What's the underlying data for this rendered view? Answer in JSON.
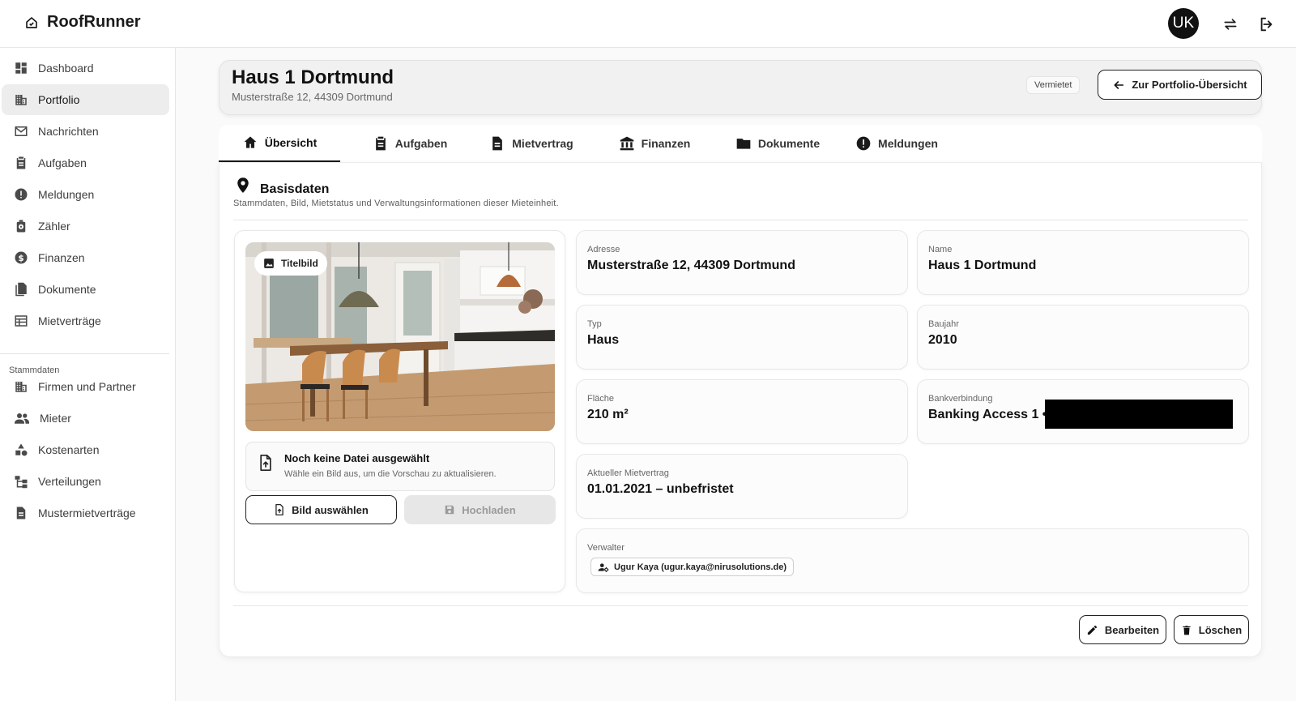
{
  "app": {
    "name": "RoofRunner"
  },
  "user": {
    "initials": "UK"
  },
  "sidebar": {
    "items": [
      {
        "label": "Dashboard",
        "icon": "dashboard-icon"
      },
      {
        "label": "Portfolio",
        "icon": "building-icon",
        "active": true
      },
      {
        "label": "Nachrichten",
        "icon": "mail-icon"
      },
      {
        "label": "Aufgaben",
        "icon": "clipboard-icon"
      },
      {
        "label": "Meldungen",
        "icon": "alert-icon"
      },
      {
        "label": "Zähler",
        "icon": "meter-icon"
      },
      {
        "label": "Finanzen",
        "icon": "dollar-icon"
      },
      {
        "label": "Dokumente",
        "icon": "documents-icon"
      },
      {
        "label": "Mietverträge",
        "icon": "table-icon"
      }
    ],
    "section_label": "Stammdaten",
    "section_items": [
      {
        "label": "Firmen und Partner",
        "icon": "building-icon"
      },
      {
        "label": "Mieter",
        "icon": "people-icon"
      },
      {
        "label": "Kostenarten",
        "icon": "category-icon"
      },
      {
        "label": "Verteilungen",
        "icon": "tree-icon"
      },
      {
        "label": "Mustermietverträge",
        "icon": "document-icon"
      }
    ]
  },
  "header": {
    "title": "Haus 1 Dortmund",
    "subtitle": "Musterstraße 12, 44309 Dortmund",
    "status_badge": "Vermietet",
    "back_button": "Zur Portfolio-Übersicht"
  },
  "tabs": [
    {
      "label": "Übersicht",
      "icon": "home-icon",
      "active": true
    },
    {
      "label": "Aufgaben",
      "icon": "clipboard-icon"
    },
    {
      "label": "Mietvertrag",
      "icon": "document-icon"
    },
    {
      "label": "Finanzen",
      "icon": "bank-icon"
    },
    {
      "label": "Dokumente",
      "icon": "folder-icon"
    },
    {
      "label": "Meldungen",
      "icon": "alert-icon"
    }
  ],
  "section": {
    "title": "Basisdaten",
    "subtitle": "Stammdaten, Bild, Mietstatus und Verwaltungsinformationen dieser Mieteinheit."
  },
  "image_card": {
    "chip_label": "Titelbild",
    "file_title": "Noch keine Datei ausgewählt",
    "file_hint": "Wähle ein Bild aus, um die Vorschau zu aktualisieren.",
    "select_button": "Bild auswählen",
    "upload_button": "Hochladen"
  },
  "fields": {
    "adresse": {
      "label": "Adresse",
      "value": "Musterstraße 12, 44309 Dortmund"
    },
    "name": {
      "label": "Name",
      "value": "Haus 1 Dortmund"
    },
    "typ": {
      "label": "Typ",
      "value": "Haus"
    },
    "baujahr": {
      "label": "Baujahr",
      "value": "2010"
    },
    "flaeche": {
      "label": "Fläche",
      "value": "210 m²"
    },
    "bank": {
      "label": "Bankverbindung",
      "value": "Banking Access 1 •"
    },
    "mietvertrag": {
      "label": "Aktueller Mietvertrag",
      "value": "01.01.2021 – unbefristet"
    },
    "verwalter": {
      "label": "Verwalter",
      "value": "Ugur Kaya (ugur.kaya@nirusolutions.de)"
    }
  },
  "actions": {
    "edit": "Bearbeiten",
    "delete": "Löschen"
  }
}
